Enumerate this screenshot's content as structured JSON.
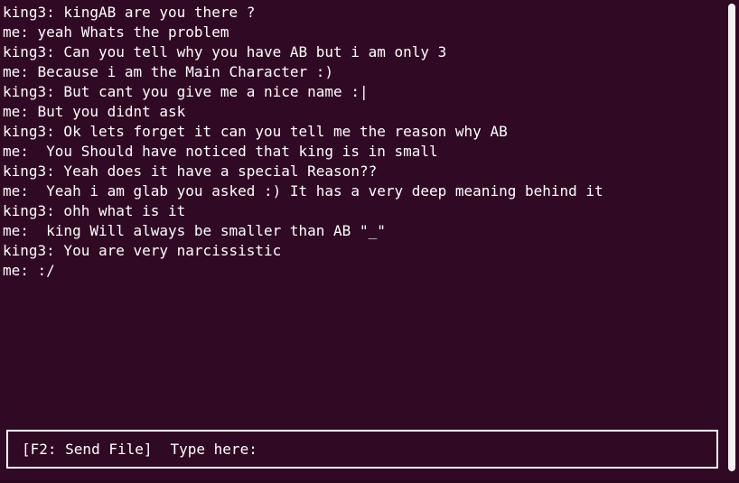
{
  "chat": {
    "lines": [
      "king3: kingAB are you there ?",
      "me: yeah Whats the problem",
      "king3: Can you tell why you have AB but i am only 3",
      "me: Because i am the Main Character :)",
      "king3: But cant you give me a nice name :|",
      "me: But you didnt ask",
      "king3: Ok lets forget it can you tell me the reason why AB",
      "me:  You Should have noticed that king is in small",
      "king3: Yeah does it have a special Reason??",
      "me:  Yeah i am glab you asked :) It has a very deep meaning behind it",
      "king3: ohh what is it",
      "me:  king Will always be smaller than AB \"_\"",
      "king3: You are very narcissistic",
      "me: :/"
    ]
  },
  "input": {
    "hint": "[F2: Send File]",
    "prompt": "Type here:"
  },
  "colors": {
    "background": "#300a24",
    "text": "#ffffff",
    "border": "#ffffff"
  }
}
